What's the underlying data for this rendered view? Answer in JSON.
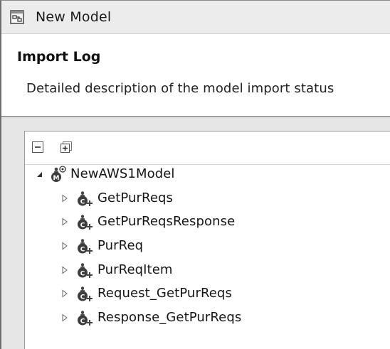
{
  "window": {
    "title": "New Model",
    "icon": "model-window-icon"
  },
  "header": {
    "title": "Import Log",
    "description": "Detailed description of the model import status"
  },
  "toolbar": {
    "collapse_icon": "collapse-all-icon",
    "expand_icon": "expand-all-icon"
  },
  "tree": {
    "root": {
      "label": "NewAWS1Model",
      "expanded": true,
      "icon": "model-icon"
    },
    "children": [
      {
        "label": "GetPurReqs",
        "icon": "class-icon"
      },
      {
        "label": "GetPurReqsResponse",
        "icon": "class-icon"
      },
      {
        "label": "PurReq",
        "icon": "class-icon"
      },
      {
        "label": "PurReqItem",
        "icon": "class-icon"
      },
      {
        "label": "Request_GetPurReqs",
        "icon": "class-icon"
      },
      {
        "label": "Response_GetPurReqs",
        "icon": "class-icon"
      }
    ]
  }
}
